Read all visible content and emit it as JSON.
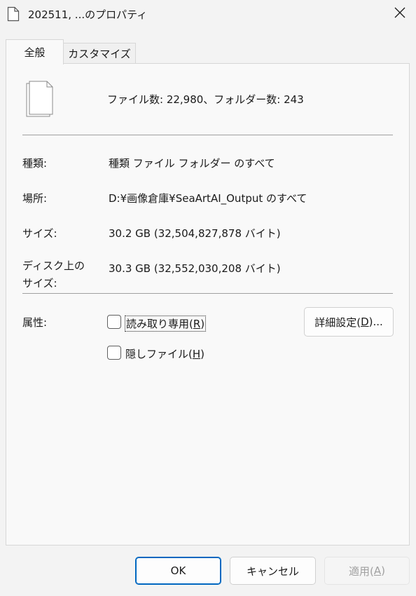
{
  "window": {
    "title": "202511, ...のプロパティ",
    "close_icon": "close-icon"
  },
  "tabs": [
    {
      "label": "全般",
      "active": true
    },
    {
      "label": "カスタマイズ",
      "active": false
    }
  ],
  "summary": {
    "icon": "multiple-files-icon",
    "count_text": "ファイル数: 22,980、フォルダー数: 243"
  },
  "properties": {
    "type_label": "種類:",
    "type_value": "種類 ファイル フォルダー のすべて",
    "location_label": "場所:",
    "location_value": "D:¥画像倉庫¥SeaArtAI_Output のすべて",
    "size_label": "サイズ:",
    "size_value": "30.2 GB (32,504,827,878 バイト)",
    "size_on_disk_label": "ディスク上のサイズ:",
    "size_on_disk_value": "30.3 GB (32,552,030,208 バイト)"
  },
  "attributes": {
    "label": "属性:",
    "readonly": {
      "text": "読み取り専用(",
      "accel": "R",
      "close": ")",
      "checked": false
    },
    "hidden": {
      "text": "隠しファイル(",
      "accel": "H",
      "close": ")",
      "checked": false
    },
    "advanced": {
      "text": "詳細設定(",
      "accel": "D",
      "close": ")..."
    }
  },
  "buttons": {
    "ok": "OK",
    "cancel": "キャンセル",
    "apply": {
      "text": "適用(",
      "accel": "A",
      "close": ")"
    }
  },
  "colors": {
    "accent": "#0067c0",
    "window_bg": "#f3f3f3",
    "panel_bg": "#f9f9f9",
    "disabled_text": "#a0a0a0"
  }
}
